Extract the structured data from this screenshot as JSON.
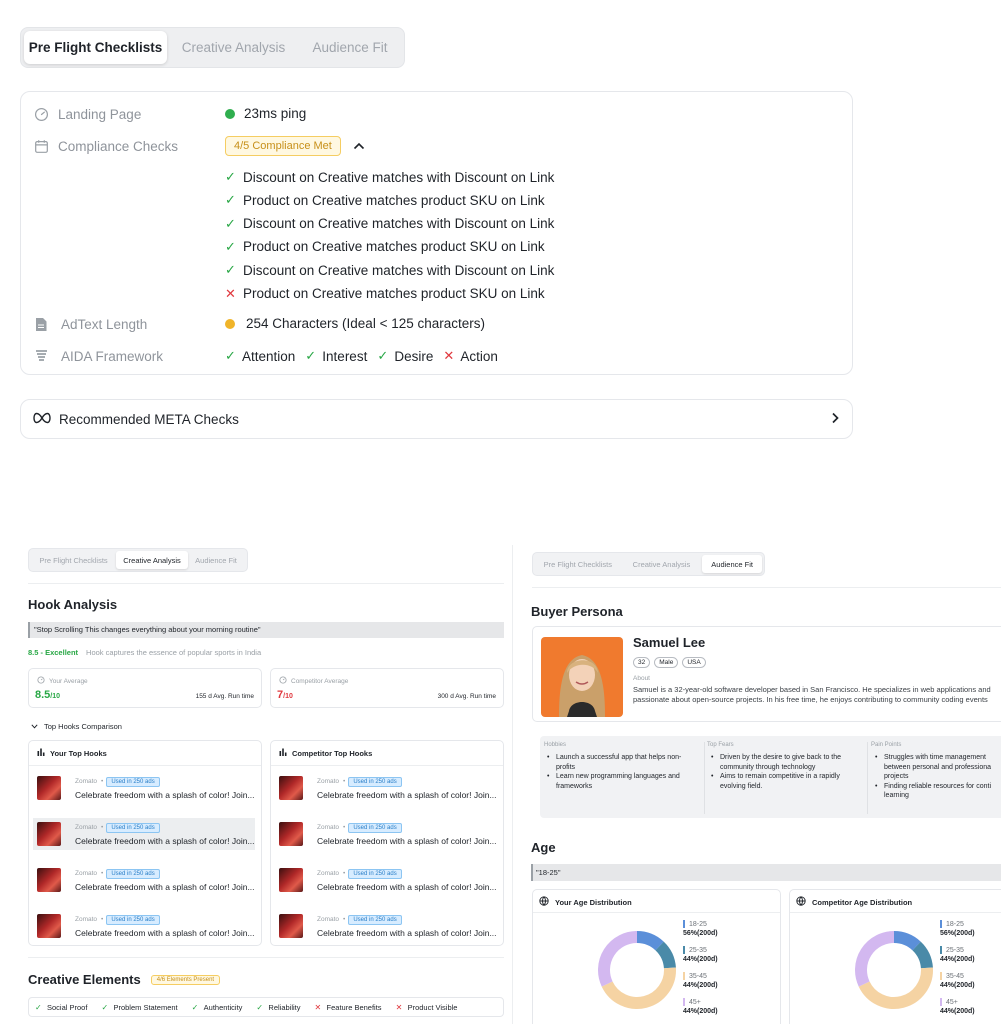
{
  "tabs": [
    "Pre Flight Checklists",
    "Creative Analysis",
    "Audience Fit"
  ],
  "checks": {
    "landing_label": "Landing Page",
    "landing_value": "23ms ping",
    "compliance_label": "Compliance Checks",
    "compliance_badge": "4/5 Compliance Met",
    "compliance_items": [
      {
        "text": "Discount on Creative matches with Discount on Link",
        "ok": true
      },
      {
        "text": "Product on Creative matches product SKU on Link",
        "ok": true
      },
      {
        "text": "Discount on Creative matches with Discount on Link",
        "ok": true
      },
      {
        "text": "Product on Creative matches product SKU on Link",
        "ok": true
      },
      {
        "text": "Discount on Creative matches with Discount on Link",
        "ok": true
      },
      {
        "text": "Product on Creative matches product SKU on Link",
        "ok": false
      }
    ],
    "adtext_label": "AdText Length",
    "adtext_value": "254 Characters (Ideal < 125 characters)",
    "aida_label": "AIDA Framework",
    "aida_items": [
      {
        "text": "Attention",
        "ok": true
      },
      {
        "text": "Interest",
        "ok": true
      },
      {
        "text": "Desire",
        "ok": true
      },
      {
        "text": "Action",
        "ok": false
      }
    ]
  },
  "meta": {
    "label": "Recommended META Checks"
  },
  "hook": {
    "title": "Hook Analysis",
    "quote": "\"Stop Scrolling This changes everything about your morning routine\"",
    "score": "8.5 - Excellent",
    "score_desc": "Hook captures the essence of  popular sports in India",
    "your_avg_label": "Your Average",
    "your_avg_value": "8.5",
    "your_avg_max": "/10",
    "your_run": "155 d Avg. Run time",
    "comp_avg_label": "Competitor Average",
    "comp_avg_value": "7",
    "comp_avg_max": "/10",
    "comp_run": "300 d Avg. Run time",
    "comparison_label": "Top Hooks Comparison",
    "your_hooks_title": "Your Top Hooks",
    "comp_hooks_title": "Competitor Top Hooks",
    "hook_brand": "Zomato",
    "hook_tag": "Used in 250 ads",
    "hook_text": "Celebrate freedom with a splash of color! Join..."
  },
  "creative": {
    "title": "Creative Elements",
    "badge": "4/6 Elements Present",
    "items": [
      {
        "text": "Social Proof",
        "ok": true
      },
      {
        "text": "Problem Statement",
        "ok": true
      },
      {
        "text": "Authenticity",
        "ok": true
      },
      {
        "text": "Reliability",
        "ok": true
      },
      {
        "text": "Feature Benefits",
        "ok": false
      },
      {
        "text": "Product Visible",
        "ok": false
      }
    ]
  },
  "persona": {
    "title": "Buyer Persona",
    "name": "Samuel Lee",
    "tags": [
      "32",
      "Male",
      "USA"
    ],
    "about_label": "About",
    "about_line1": "Samuel is a 32-year-old software developer based in San Francisco. He specializes in web applications and",
    "about_line2": "passionate about open-source projects. In his free time, he enjoys contributing to community coding events",
    "hobbies_label": "Hobbies",
    "hobbies": [
      "Launch a successful app that helps non-",
      "profits",
      "Learn new programming languages and",
      "frameworks"
    ],
    "fears_label": "Top Fears",
    "fears": [
      "Driven by the desire to give back to the",
      "community through technology",
      "Aims to remain competitive in a rapidly",
      "evolving field."
    ],
    "pains_label": "Pain Points",
    "pains": [
      "Struggles with time management",
      "between personal and professiona",
      "projects",
      "Finding reliable resources for conti",
      "learning"
    ]
  },
  "age": {
    "title": "Age",
    "selected": "\"18-25\"",
    "your_title": "Your Age Distribution",
    "comp_title": "Competitor Age Distribution"
  },
  "chart_data": [
    {
      "type": "pie",
      "title": "Your Age Distribution",
      "categories": [
        "18-25",
        "25-35",
        "35-45",
        "45+"
      ],
      "labels": [
        "56%(200d)",
        "44%(200d)",
        "44%(200d)",
        "44%(200d)"
      ],
      "values": [
        12,
        12,
        44,
        32
      ],
      "colors": [
        "#5b8fd9",
        "#4a8aa8",
        "#f5d3a3",
        "#d3b8f0"
      ],
      "legend": "right"
    },
    {
      "type": "pie",
      "title": "Competitor Age Distribution",
      "categories": [
        "18-25",
        "25-35",
        "35-45",
        "45+"
      ],
      "labels": [
        "56%(200d)",
        "44%(200d)",
        "44%(200d)",
        "44%(200d)"
      ],
      "values": [
        12,
        12,
        44,
        32
      ],
      "colors": [
        "#5b8fd9",
        "#4a8aa8",
        "#f5d3a3",
        "#d3b8f0"
      ],
      "legend": "right"
    }
  ],
  "colors": {
    "green": "#28a745",
    "red": "#e0383e",
    "amber": "#f0b429",
    "blue_tag": "#2a7fc8"
  }
}
